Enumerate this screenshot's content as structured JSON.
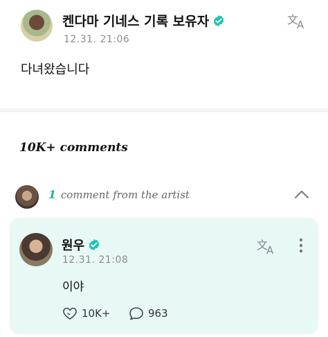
{
  "post": {
    "author": "켄다마 기네스 기록 보유자",
    "time": "12.31. 21:06",
    "text": "다녀왔습니다"
  },
  "comments": {
    "count_label": "10K+ comments"
  },
  "artist_comments": {
    "count": "1",
    "label": "comment from the artist"
  },
  "reply": {
    "author": "원우",
    "time": "12.31. 21:08",
    "text": "이야",
    "likes": "10K+",
    "replies": "963"
  },
  "colors": {
    "accent": "#10b7a8",
    "verified": "#1fc2b3",
    "card_bg": "#e7f8f5"
  },
  "icons": [
    "verified-badge-icon",
    "translate-icon",
    "chevron-up-icon",
    "more-vertical-icon",
    "heart-icon",
    "comment-icon"
  ]
}
